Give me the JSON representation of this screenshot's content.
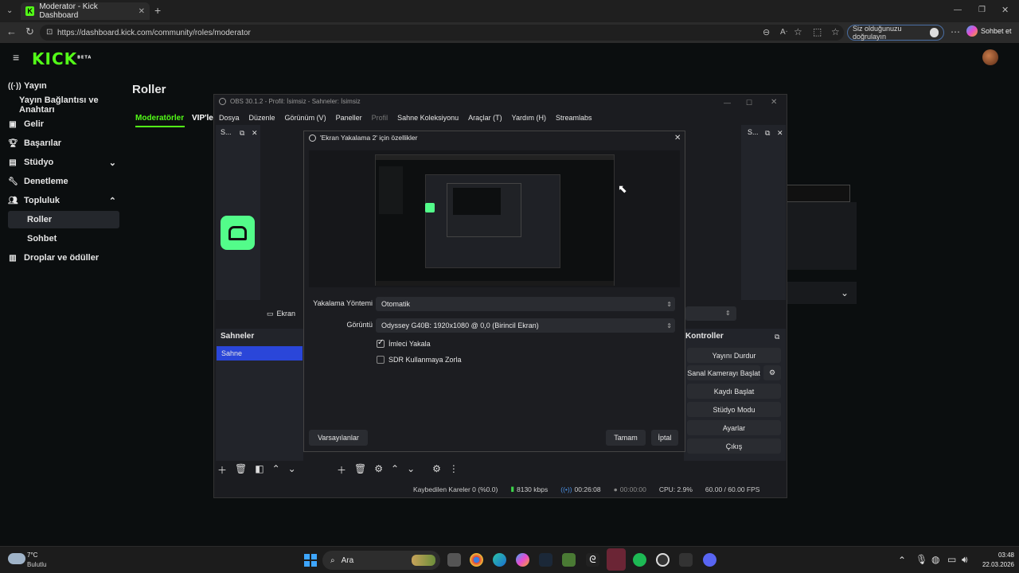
{
  "browser": {
    "tab_title": "Moderator - Kick Dashboard",
    "url": "https://dashboard.kick.com/community/roles/moderator",
    "verify_label": "Siz olduğunuzu doğrulayın",
    "copilot_label": "Sohbet et"
  },
  "kick": {
    "logo": "KICK",
    "logo_badge": "BETA",
    "page_title": "Roller",
    "tabs": [
      "Moderatörler",
      "VIP'le"
    ],
    "nav": [
      {
        "label": "Yayın",
        "icon": "broadcast-icon"
      },
      {
        "label": "Yayın Bağlantısı ve Anahtarı",
        "icon": ""
      },
      {
        "label": "Gelir",
        "icon": "revenue-icon"
      },
      {
        "label": "Başarılar",
        "icon": "trophy-icon"
      },
      {
        "label": "Stüdyo",
        "icon": "studio-icon"
      },
      {
        "label": "Denetleme",
        "icon": "wrench-icon"
      },
      {
        "label": "Topluluk",
        "icon": "community-icon"
      },
      {
        "label": "Roller",
        "icon": ""
      },
      {
        "label": "Sohbet",
        "icon": ""
      },
      {
        "label": "Droplar ve ödüller",
        "icon": "gift-icon"
      }
    ]
  },
  "obs": {
    "title": "OBS 30.1.2 - Profil: İsimsiz - Sahneler: İsimsiz",
    "menu": [
      "Dosya",
      "Düzenle",
      "Görünüm (V)",
      "Paneller",
      "Profil",
      "Sahne Koleksiyonu",
      "Araçlar (T)",
      "Yardım (H)",
      "Streamlabs"
    ],
    "panel_left_title": "S...",
    "panel_right_title": "S...",
    "source_peek": "Ekran",
    "scenes_title": "Sahneler",
    "scene_item": "Sahne",
    "controls_title": "Kontroller",
    "controls": [
      "Yayını Durdur",
      "Sanal Kamerayı Başlat",
      "Kaydı Başlat",
      "Stüdyo Modu",
      "Ayarlar",
      "Çıkış"
    ],
    "status": {
      "dropped": "Kaybedilen Kareler 0 (%0.0)",
      "bitrate": "8130 kbps",
      "stream_time": "00:26:08",
      "rec_time": "00:00:00",
      "cpu": "CPU: 2.9%",
      "fps": "60.00 / 60.00 FPS"
    }
  },
  "dialog": {
    "title": "'Ekran Yakalama 2' için özellikler",
    "method_label": "Yakalama Yöntemi",
    "method_value": "Otomatik",
    "display_label": "Görüntü",
    "display_value": "Odyssey G40B: 1920x1080 @ 0,0 (Birincil Ekran)",
    "cursor_label": "İmleci Yakala",
    "cursor_checked": true,
    "sdr_label": "SDR Kullanmaya Zorla",
    "sdr_checked": false,
    "defaults_button": "Varsayılanlar",
    "ok_button": "Tamam",
    "cancel_button": "İptal"
  },
  "taskbar": {
    "weather_temp": "7°C",
    "weather_desc": "Bulutlu",
    "search_label": "Ara",
    "time": "03:48",
    "date": "22.03.2026"
  },
  "colors": {
    "kick_green": "#53fc18",
    "scene_selected": "#2a46d9",
    "obs_bg": "#1b1c20"
  }
}
